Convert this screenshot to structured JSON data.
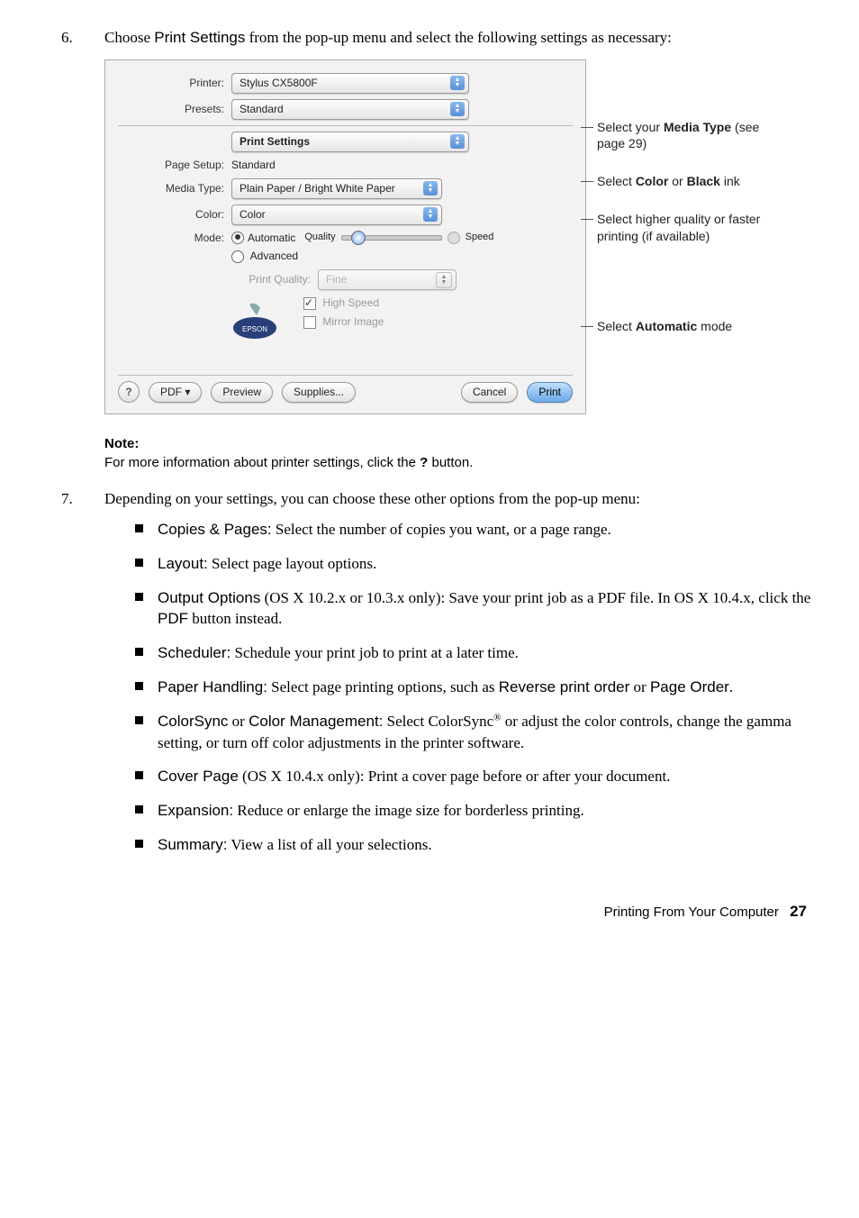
{
  "step6": {
    "num": "6.",
    "text_before": "Choose ",
    "text_bold": "Print Settings",
    "text_after": " from the pop-up menu and select the following settings as necessary:"
  },
  "dialog": {
    "printer_label": "Printer:",
    "printer_value": "Stylus CX5800F",
    "presets_label": "Presets:",
    "presets_value": "Standard",
    "section_value": "Print Settings",
    "pagesetup_label": "Page Setup:",
    "pagesetup_value": "Standard",
    "mediatype_label": "Media Type:",
    "mediatype_value": "Plain Paper / Bright White Paper",
    "color_label": "Color:",
    "color_value": "Color",
    "mode_label": "Mode:",
    "mode_auto": "Automatic",
    "mode_adv": "Advanced",
    "quality_word": "Quality",
    "speed_word": "Speed",
    "pq_label": "Print Quality:",
    "pq_value": "Fine",
    "high_speed": "High Speed",
    "mirror": "Mirror Image",
    "help": "?",
    "pdf": "PDF ▾",
    "preview": "Preview",
    "supplies": "Supplies...",
    "cancel": "Cancel",
    "print": "Print"
  },
  "callouts": {
    "c1a": "Select your ",
    "c1b": "Media Type",
    "c1c": " (see page 29)",
    "c2a": "Select ",
    "c2b": "Color",
    "c2c": " or ",
    "c2d": "Black",
    "c2e": " ink",
    "c3": "Select higher quality or faster printing (if available)",
    "c4a": "Select ",
    "c4b": "Automatic",
    "c4c": " mode"
  },
  "note": {
    "title": "Note:",
    "body_before": "For more information about printer settings, click the ",
    "body_bold": "?",
    "body_after": " button."
  },
  "step7": {
    "num": "7.",
    "text": "Depending on your settings, you can choose these other options from the pop-up menu:"
  },
  "bullets": [
    {
      "b": "Copies & Pages:",
      "t": " Select the number of copies you want, or a page range."
    },
    {
      "b": "Layout:",
      "t": " Select page layout options."
    },
    {
      "b": "Output Options",
      "t": " (OS X 10.2.x or 10.3.x only): Save your print job as a PDF file. In OS X 10.4.x, click the ",
      "b2": "PDF",
      "t2": " button instead."
    },
    {
      "b": "Scheduler:",
      "t": " Schedule your print job to print at a later time."
    },
    {
      "b": "Paper Handling:",
      "t": " Select page printing options, such as ",
      "b2": "Reverse print order",
      "t2": " or ",
      "b3": "Page Order",
      "t3": "."
    },
    {
      "b": "ColorSync",
      "mid": " or ",
      "b1a": "Color Management:",
      "t": " Select ColorSync",
      "sup": "®",
      "t2": " or adjust the color controls, change the gamma setting, or turn off color adjustments in the printer software."
    },
    {
      "b": "Cover Page",
      "t": " (OS X 10.4.x only): Print a cover page before or after your document."
    },
    {
      "b": "Expansion:",
      "t": " Reduce or enlarge the image size for borderless printing."
    },
    {
      "b": "Summary:",
      "t": " View a list of all your selections."
    }
  ],
  "footer": {
    "text": "Printing From Your Computer",
    "page": "27"
  }
}
